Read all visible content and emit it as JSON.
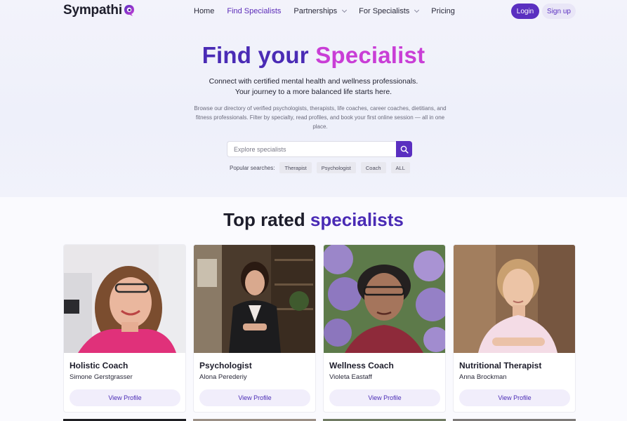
{
  "brand": {
    "name": "Sympathi",
    "accent": "#5a2fc0",
    "accent_pink": "#c93ed6"
  },
  "nav": {
    "items": [
      {
        "label": "Home",
        "active": false,
        "dropdown": false
      },
      {
        "label": "Find Specialists",
        "active": true,
        "dropdown": false
      },
      {
        "label": "Partnerships",
        "active": false,
        "dropdown": true
      },
      {
        "label": "For Specialists",
        "active": false,
        "dropdown": true
      },
      {
        "label": "Pricing",
        "active": false,
        "dropdown": false
      }
    ],
    "login_label": "Login",
    "signup_label": "Sign up"
  },
  "hero": {
    "title_part1": "Find your",
    "title_part2": "Specialist",
    "subtitle_line1": "Connect with certified mental health and wellness professionals.",
    "subtitle_line2": "Your journey to a more balanced life starts here.",
    "description": "Browse our directory of verified psychologists, therapists, life coaches, career coaches, dietitians, and fitness professionals. Filter by specialty, read profiles, and book your first online session — all in one place."
  },
  "search": {
    "placeholder": "Explore specialists",
    "value": "",
    "icon": "search-icon"
  },
  "popular": {
    "label": "Popular searches:",
    "chips": [
      "Therapist",
      "Psychologist",
      "Coach",
      "ALL"
    ]
  },
  "top_rated": {
    "title_part1": "Top rated",
    "title_part2": "specialists",
    "cards": [
      {
        "role": "Holistic Coach",
        "name": "Simone Gerstgrasser",
        "button": "View Profile"
      },
      {
        "role": "Psychologist",
        "name": "Alona Perederiy",
        "button": "View Profile"
      },
      {
        "role": "Wellness Coach",
        "name": "Violeta Eastaff",
        "button": "View Profile"
      },
      {
        "role": "Nutritional Therapist",
        "name": "Anna Brockman",
        "button": "View Profile"
      }
    ]
  }
}
